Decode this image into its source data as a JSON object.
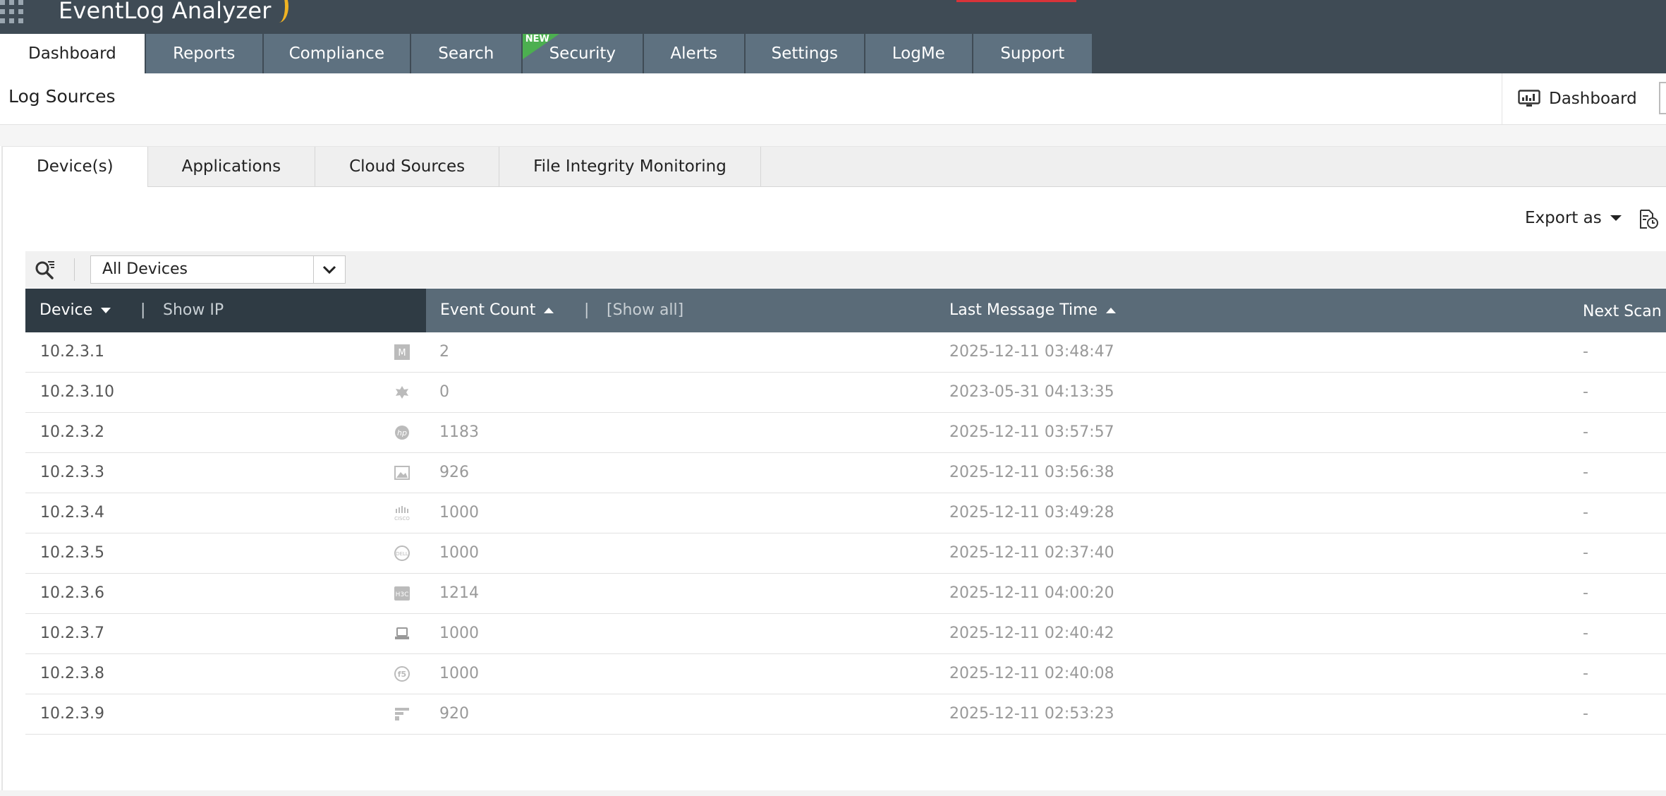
{
  "app": {
    "title": "EventLog Analyzer"
  },
  "nav": {
    "tabs": [
      {
        "label": "Dashboard",
        "active": true
      },
      {
        "label": "Reports"
      },
      {
        "label": "Compliance"
      },
      {
        "label": "Search"
      },
      {
        "label": "Security",
        "badge": "NEW"
      },
      {
        "label": "Alerts"
      },
      {
        "label": "Settings"
      },
      {
        "label": "LogMe"
      },
      {
        "label": "Support"
      }
    ]
  },
  "page": {
    "title": "Log Sources",
    "dashboard_button": "Dashboard"
  },
  "subtabs": [
    {
      "label": "Device(s)",
      "active": true
    },
    {
      "label": "Applications"
    },
    {
      "label": "Cloud Sources"
    },
    {
      "label": "File Integrity Monitoring"
    }
  ],
  "toolbar": {
    "export_label": "Export as"
  },
  "filter": {
    "selected": "All Devices"
  },
  "table": {
    "headers": {
      "device": "Device",
      "show_ip": "Show IP",
      "event_count": "Event Count",
      "show_all": "[Show all]",
      "last_message_time": "Last Message Time",
      "next_scan": "Next Scan"
    },
    "rows": [
      {
        "device": "10.2.3.1",
        "icon": "m-icon",
        "count": "2",
        "time": "2025-12-11 03:48:47",
        "next": "-"
      },
      {
        "device": "10.2.3.10",
        "icon": "gear-leaf-icon",
        "count": "0",
        "time": "2023-05-31 04:13:35",
        "next": "-"
      },
      {
        "device": "10.2.3.2",
        "icon": "hp-icon",
        "count": "1183",
        "time": "2025-12-11 03:57:57",
        "next": "-"
      },
      {
        "device": "10.2.3.3",
        "icon": "image-icon",
        "count": "926",
        "time": "2025-12-11 03:56:38",
        "next": "-"
      },
      {
        "device": "10.2.3.4",
        "icon": "cisco-icon",
        "count": "1000",
        "time": "2025-12-11 03:49:28",
        "next": "-"
      },
      {
        "device": "10.2.3.5",
        "icon": "dell-icon",
        "count": "1000",
        "time": "2025-12-11 02:37:40",
        "next": "-"
      },
      {
        "device": "10.2.3.6",
        "icon": "h3c-icon",
        "count": "1214",
        "time": "2025-12-11 04:00:20",
        "next": "-"
      },
      {
        "device": "10.2.3.7",
        "icon": "laptop-icon",
        "count": "1000",
        "time": "2025-12-11 02:40:42",
        "next": "-"
      },
      {
        "device": "10.2.3.8",
        "icon": "f5-icon",
        "count": "1000",
        "time": "2025-12-11 02:40:08",
        "next": "-"
      },
      {
        "device": "10.2.3.9",
        "icon": "fortinet-icon",
        "count": "920",
        "time": "2025-12-11 02:53:23",
        "next": "-"
      }
    ]
  },
  "colors": {
    "header_bg": "#3f4b55",
    "nav_tab_bg": "#5e7180",
    "table_head_bg": "#5a6b78",
    "device_head_bg": "#2f3b44",
    "badge_green": "#4caf50",
    "brand_accent": "#f0b323"
  }
}
